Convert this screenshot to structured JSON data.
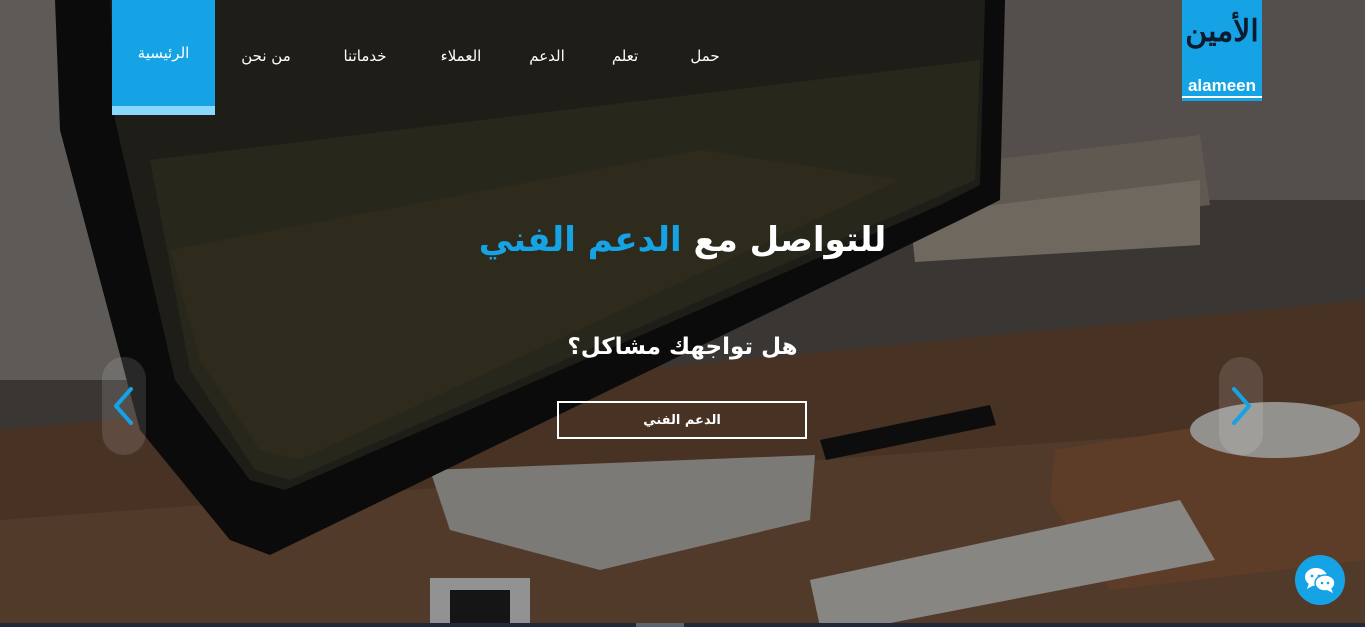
{
  "nav": {
    "items": [
      {
        "label": "الرئيسية",
        "active": true
      },
      {
        "label": "من نحن",
        "active": false
      },
      {
        "label": "خدماتنا",
        "active": false
      },
      {
        "label": "العملاء",
        "active": false
      },
      {
        "label": "الدعم",
        "active": false
      },
      {
        "label": "تعلم",
        "active": false
      },
      {
        "label": "حمل",
        "active": false
      }
    ]
  },
  "logo": {
    "arabic": "الأمين",
    "english": "alameen"
  },
  "hero": {
    "headline_main": "للتواصل مع",
    "headline_accent": "الدعم الفني",
    "subline": "هل تواجهك مشاكل؟",
    "cta_label": "الدعم الفني"
  },
  "carousel": {
    "prev_icon": "chevron-left-icon",
    "next_icon": "chevron-right-icon"
  },
  "chat": {
    "icon": "chat-bubbles-icon"
  },
  "colors": {
    "accent": "#16a3e6",
    "active_underline": "#8ad8ff",
    "text": "#ffffff"
  }
}
